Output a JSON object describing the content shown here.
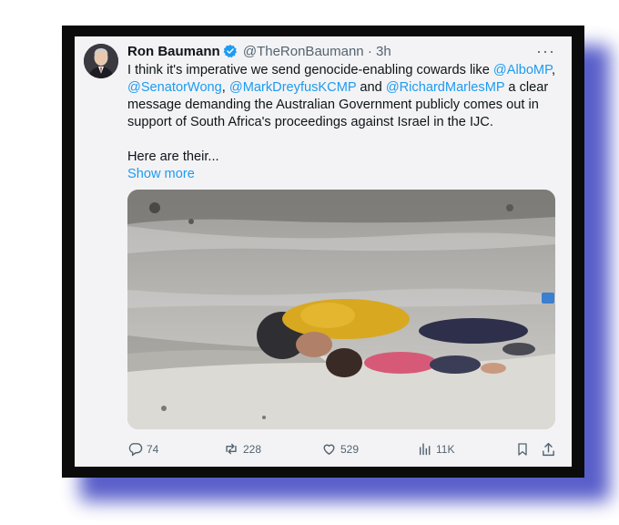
{
  "tweet": {
    "author_name": "Ron Baumann",
    "handle": "@TheRonBaumann",
    "separator": "·",
    "time": "3h",
    "more_label": "···",
    "text": {
      "t1": "I think it's imperative we send genocide-enabling cowards like ",
      "m1": "@AlboMP",
      "t2": ", ",
      "m2": "@SenatorWong",
      "t3": ", ",
      "m3": "@MarkDreyfusKCMP",
      "t4": " and ",
      "m4": "@RichardMarlesMP",
      "t5": " a clear message demanding the Australian Government publicly comes out in support of South Africa's proceedings against Israel in the IJC.",
      "p2": "Here are their...",
      "show_more": "Show more"
    },
    "media_icon": "photo-of-children-lying-on-ground",
    "stats": {
      "replies": "74",
      "retweets": "228",
      "likes": "529",
      "views": "11K"
    }
  },
  "icons": {
    "verified": "verified-badge-icon",
    "reply": "reply-icon",
    "retweet": "retweet-icon",
    "like": "heart-icon",
    "views": "views-icon",
    "bookmark": "bookmark-icon",
    "share": "share-icon"
  },
  "colors": {
    "accent": "#1d9bf0",
    "frame": "#0b0b0b",
    "shadow": "#3c42c0",
    "muted": "#536471"
  }
}
